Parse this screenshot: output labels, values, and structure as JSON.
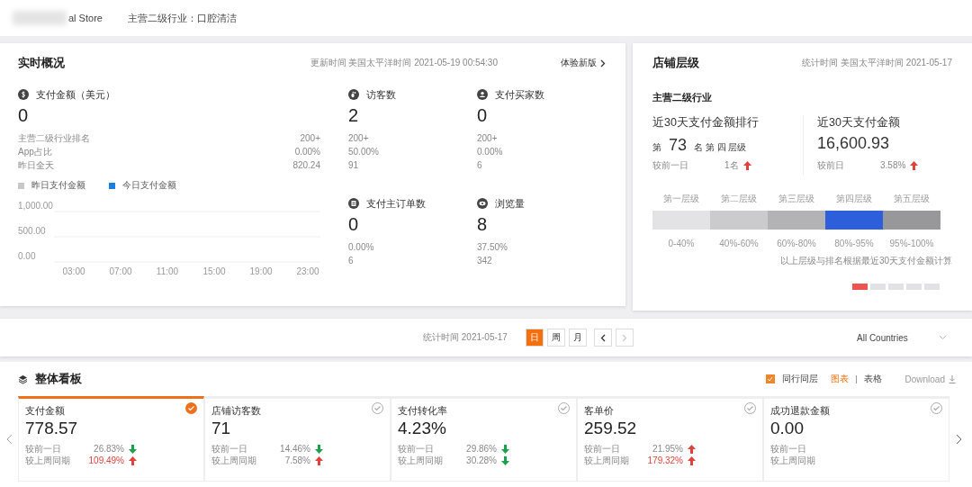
{
  "header": {
    "store_name": "al Store",
    "industry": "主营二级行业：口腔清洁"
  },
  "realtime": {
    "title": "实时概况",
    "update_time": "更新时间 美国太平洋时间 2021-05-19 00:54:30",
    "new_version_link": "体验新版",
    "payment": {
      "label": "支付金额（美元）",
      "value": "0",
      "stats": [
        {
          "label": "主营二级行业排名",
          "value": "200+"
        },
        {
          "label": "App占比",
          "value": "0.00%"
        },
        {
          "label": "昨日全天",
          "value": "820.24"
        }
      ]
    },
    "metrics": [
      {
        "kind": "visitors",
        "label": "访客数",
        "value": "2",
        "lines": [
          "200+",
          "50.00%",
          "91"
        ]
      },
      {
        "kind": "buyers",
        "label": "支付买家数",
        "value": "0",
        "lines": [
          "200+",
          "0.00%",
          "6"
        ]
      },
      {
        "kind": "orders",
        "label": "支付主订单数",
        "value": "0",
        "lines": [
          "0.00%",
          "6"
        ]
      },
      {
        "kind": "views",
        "label": "浏览量",
        "value": "8",
        "lines": [
          "37.50%",
          "342"
        ]
      }
    ],
    "chart_data": {
      "type": "line",
      "categories": [
        "03:00",
        "07:00",
        "11:00",
        "15:00",
        "19:00",
        "23:00"
      ],
      "ylim": [
        0,
        1000
      ],
      "yticks": [
        {
          "value": 0,
          "label": "0.00"
        },
        {
          "value": 500,
          "label": "500.00"
        },
        {
          "value": 1000,
          "label": "1,000.00"
        }
      ],
      "series": [
        {
          "name": "昨日支付金额",
          "color": "#c8c8c8",
          "values": [
            null,
            null,
            null,
            null,
            null,
            null
          ]
        },
        {
          "name": "今日支付金额",
          "color": "#1a7fe0",
          "values": [
            null,
            null,
            null,
            null,
            null,
            null
          ]
        }
      ]
    }
  },
  "store_level": {
    "title": "店铺层级",
    "stat_time": "统计时间 美国太平洋时间 2021-05-17",
    "subtitle": "主营二级行业",
    "rank": {
      "label": "近30天支付金额排行",
      "prefix": "第",
      "number": "73",
      "suffix": "名 第 四 层级",
      "compare_label": "较前一日",
      "compare_value": "1名",
      "kind": "up"
    },
    "amount": {
      "label": "近30天支付金额",
      "value": "16,600.93",
      "compare_label": "较前日",
      "compare_value": "3.58%",
      "kind": "up"
    },
    "tiers": [
      {
        "label": "第一层级",
        "range": "0-40%",
        "color": "#e3e3e5"
      },
      {
        "label": "第二层级",
        "range": "40%-60%",
        "color": "#cbcbcd"
      },
      {
        "label": "第三层级",
        "range": "60%-80%",
        "color": "#b3b3b5"
      },
      {
        "label": "第四层级",
        "range": "80%-95%",
        "color": "#2d5fdc"
      },
      {
        "label": "第五层级",
        "range": "95%-100%",
        "color": "#98989a"
      }
    ],
    "note": "以上层级与排名根据最近30天支付金额计算",
    "pages": [
      {
        "selected": true
      },
      {
        "selected": false
      },
      {
        "selected": false
      },
      {
        "selected": false
      },
      {
        "selected": false
      }
    ]
  },
  "filter": {
    "stat_time": "统计时间 2021-05-17",
    "periods": [
      {
        "label": "日",
        "selected": true
      },
      {
        "label": "周",
        "selected": false
      },
      {
        "label": "月",
        "selected": false
      }
    ],
    "prev_disabled": false,
    "next_disabled": true,
    "country": "All Countries"
  },
  "dashboard": {
    "title": "整体看板",
    "peer_checkbox": {
      "label": "同行同层",
      "checked": true
    },
    "views": [
      {
        "label": "图表",
        "selected": true
      },
      {
        "label": "表格",
        "selected": false
      }
    ],
    "download": "Download",
    "cards": [
      {
        "label": "支付金额",
        "value": "778.57",
        "selected": true,
        "rows": [
          {
            "label": "较前一日",
            "value": "26.83%",
            "kind": "down",
            "highlight": false
          },
          {
            "label": "较上周同期",
            "value": "109.49%",
            "kind": "up",
            "highlight": true
          }
        ]
      },
      {
        "label": "店铺访客数",
        "value": "71",
        "selected": false,
        "rows": [
          {
            "label": "较前一日",
            "value": "14.46%",
            "kind": "down",
            "highlight": false
          },
          {
            "label": "较上周同期",
            "value": "7.58%",
            "kind": "up",
            "highlight": false
          }
        ]
      },
      {
        "label": "支付转化率",
        "value": "4.23%",
        "selected": false,
        "rows": [
          {
            "label": "较前一日",
            "value": "29.86%",
            "kind": "down",
            "highlight": false
          },
          {
            "label": "较上周同期",
            "value": "30.28%",
            "kind": "down",
            "highlight": false
          }
        ]
      },
      {
        "label": "客单价",
        "value": "259.52",
        "selected": false,
        "rows": [
          {
            "label": "较前一日",
            "value": "21.95%",
            "kind": "up",
            "highlight": false
          },
          {
            "label": "较上周同期",
            "value": "179.32%",
            "kind": "up",
            "highlight": true
          }
        ]
      },
      {
        "label": "成功退款金额",
        "value": "0.00",
        "selected": false,
        "rows": [
          {
            "label": "较前一日"
          },
          {
            "label": "较上周同期"
          }
        ]
      }
    ]
  }
}
